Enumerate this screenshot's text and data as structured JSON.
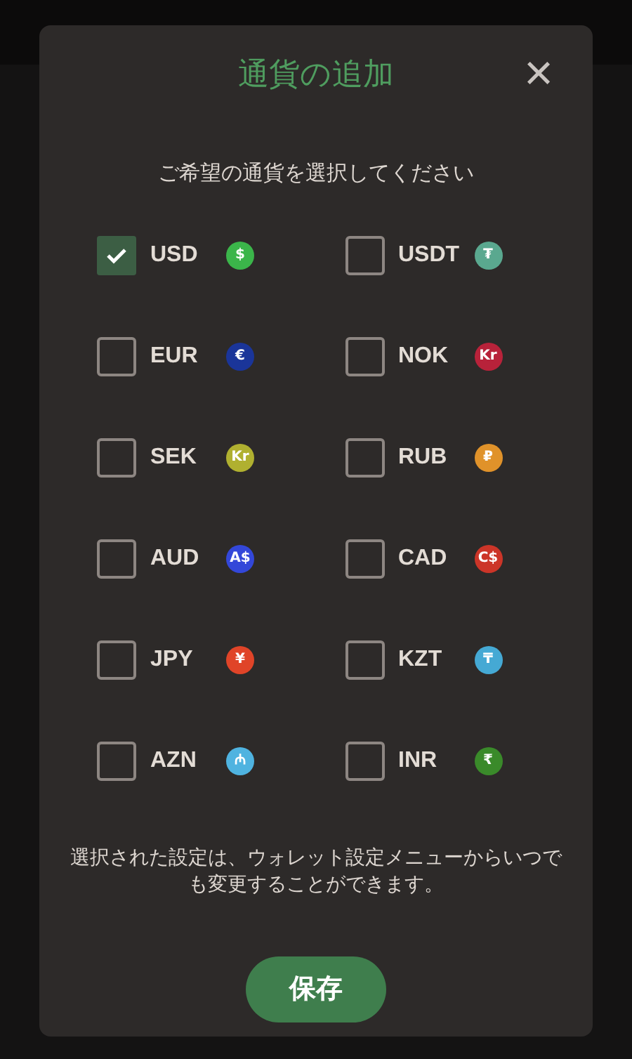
{
  "dialog": {
    "title": "通貨の追加",
    "close": "×",
    "subtitle": "ご希望の通貨を選択してください",
    "currencies": [
      {
        "code": "USD",
        "symbol": "$",
        "color": "#3bb54a",
        "checked": true
      },
      {
        "code": "USDT",
        "symbol": "₮",
        "color": "#5aa88f",
        "checked": false
      },
      {
        "code": "EUR",
        "symbol": "€",
        "color": "#1a3599",
        "checked": false
      },
      {
        "code": "NOK",
        "symbol": "Kr",
        "color": "#b8223a",
        "checked": false
      },
      {
        "code": "SEK",
        "symbol": "Kr",
        "color": "#b0b030",
        "checked": false
      },
      {
        "code": "RUB",
        "symbol": "₽",
        "color": "#e0922a",
        "checked": false
      },
      {
        "code": "AUD",
        "symbol": "A$",
        "color": "#3347d9",
        "checked": false
      },
      {
        "code": "CAD",
        "symbol": "C$",
        "color": "#cc3528",
        "checked": false
      },
      {
        "code": "JPY",
        "symbol": "¥",
        "color": "#e04428",
        "checked": false
      },
      {
        "code": "KZT",
        "symbol": "₸",
        "color": "#45a9d4",
        "checked": false
      },
      {
        "code": "AZN",
        "symbol": "₼",
        "color": "#4fb3e0",
        "checked": false
      },
      {
        "code": "INR",
        "symbol": "₹",
        "color": "#3a8a2a",
        "checked": false
      }
    ],
    "note": "選択された設定は、ウォレット設定メニューからいつでも変更することができます。",
    "save": "保存"
  }
}
